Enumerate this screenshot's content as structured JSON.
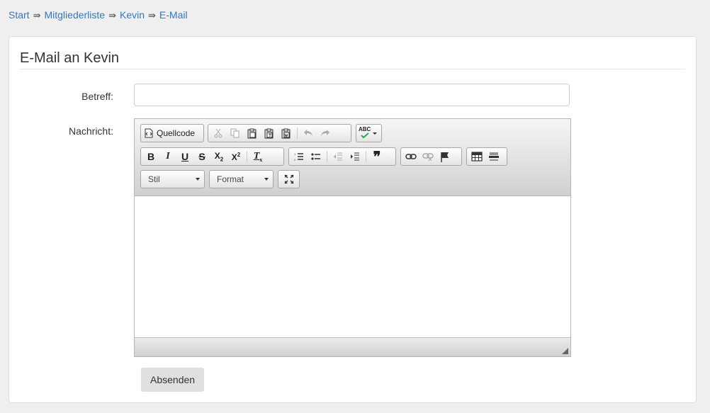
{
  "breadcrumb": {
    "items": [
      "Start",
      "Mitgliederliste",
      "Kevin",
      "E-Mail"
    ],
    "separator": "⇛"
  },
  "panel": {
    "title": "E-Mail an Kevin"
  },
  "form": {
    "subject_label": "Betreff:",
    "subject_value": "",
    "message_label": "Nachricht:",
    "submit_label": "Absenden"
  },
  "editor": {
    "toolbar_row1": {
      "source_label": "Quellcode",
      "icons": [
        "cut-icon",
        "copy-icon",
        "paste-icon",
        "paste-text-icon",
        "paste-word-icon",
        "undo-icon",
        "redo-icon",
        "spellcheck-icon"
      ],
      "spellcheck_label": "ABC"
    },
    "toolbar_row2": {
      "bold": "B",
      "italic": "I",
      "underline": "U",
      "strike": "S",
      "subscript": "X",
      "subscript_mark": "2",
      "superscript": "X",
      "superscript_mark": "2",
      "remove_format": "T",
      "remove_format_mark": "x",
      "blockquote": "❞",
      "icons": [
        "bold-icon",
        "italic-icon",
        "underline-icon",
        "strikethrough-icon",
        "subscript-icon",
        "superscript-icon",
        "remove-format-icon",
        "numbered-list-icon",
        "bulleted-list-icon",
        "outdent-icon",
        "indent-icon",
        "blockquote-icon",
        "link-icon",
        "unlink-icon",
        "anchor-icon",
        "table-icon",
        "horizontal-line-icon"
      ]
    },
    "toolbar_row3": {
      "style_label": "Stil",
      "format_label": "Format",
      "icons": [
        "maximize-icon"
      ]
    },
    "content": ""
  },
  "colors": {
    "background": "#efefef",
    "link": "#3a76b8",
    "panel": "#ffffff",
    "button": "#e0e0e0"
  }
}
